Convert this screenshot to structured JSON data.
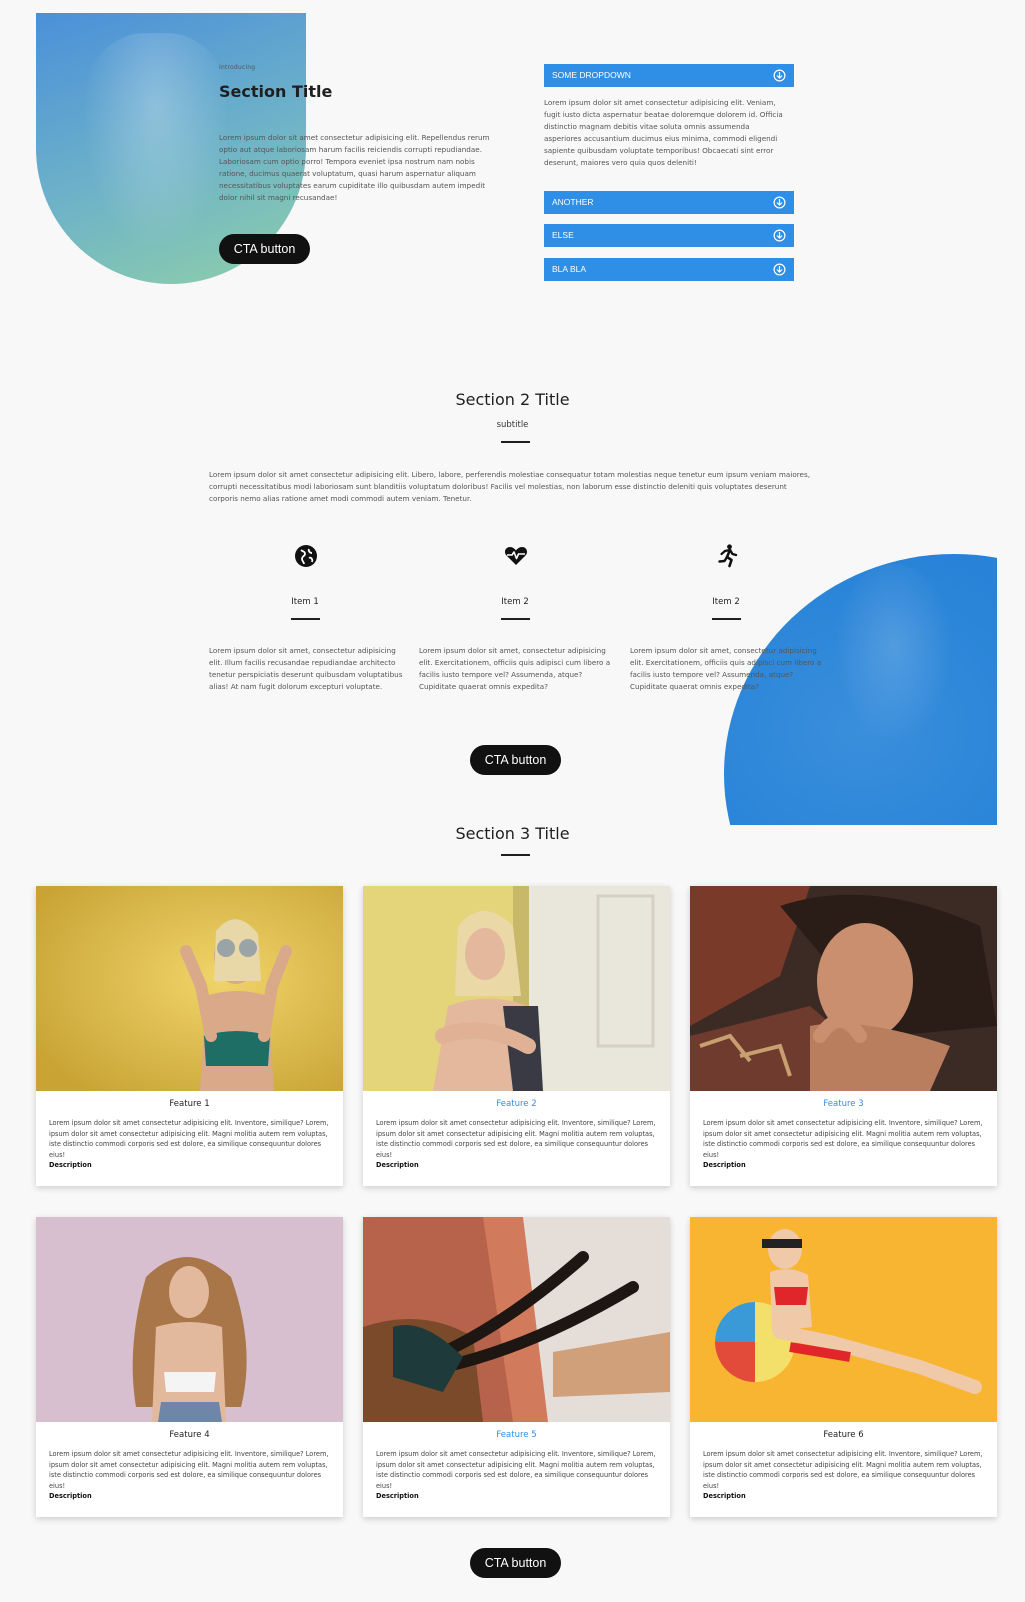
{
  "section1": {
    "eyebrow": "Introducing",
    "title": "Section Title",
    "body": "Lorem ipsum dolor sit amet consectetur adipisicing elit. Repellendus rerum optio aut atque laboriosam harum facilis reiciendis corrupti repudiandae. Laboriosam cum optio porro! Tempora eveniet ipsa nostrum nam nobis ratione, ducimus quaerat voluptatum, quasi harum aspernatur aliquam necessitatibus voluptates earum cupiditate illo quibusdam autem impedit dolor nihil sit magni recusandae!",
    "cta_label": "CTA button"
  },
  "accordion": {
    "items": [
      {
        "label": "SOME DROPDOWN",
        "icon": "chevron-circle-down-icon"
      },
      {
        "label": "ANOTHER",
        "icon": "chevron-circle-down-icon"
      },
      {
        "label": "ELSE",
        "icon": "chevron-circle-down-icon"
      },
      {
        "label": "BLA BLA",
        "icon": "chevron-circle-down-icon"
      }
    ],
    "open_body": "Lorem ipsum dolor sit amet consectetur adipisicing elit. Veniam, fugit iusto dicta aspernatur beatae doloremque dolorem id. Officia distinctio magnam debitis vitae soluta omnis assumenda asperiores accusantium ducimus eius minima, commodi eligendi sapiente quibusdam voluptate temporibus! Obcaecati sint error deserunt, maiores vero quia quos deleniti!",
    "accent_color": "#2f8ee6"
  },
  "section2": {
    "title": "Section 2 Title",
    "subtitle": "subtitle",
    "body": "Lorem ipsum dolor sit amet consectetur adipisicing elit. Libero, labore, perferendis molestiae consequatur totam molestias neque tenetur eum ipsum veniam maiores, corrupti necessitatibus modi laboriosam sunt blanditiis voluptatum doloribus! Facilis vel molestias, non laborum esse distinctio deleniti quis voluptates deserunt corporis nemo alias ratione amet modi commodi autem veniam. Tenetur.",
    "items": [
      {
        "icon": "globe-icon",
        "label": "Item 1",
        "text": "Lorem ipsum dolor sit amet, consectetur adipisicing elit. Illum facilis recusandae repudiandae architecto tenetur perspiciatis deserunt quibusdam voluptatibus alias! At nam fugit dolorum excepturi voluptate."
      },
      {
        "icon": "heartbeat-icon",
        "label": "Item 2",
        "text": "Lorem ipsum dolor sit amet, consectetur adipisicing elit. Exercitationem, officiis quis adipisci cum libero a facilis iusto tempore vel? Assumenda, atque? Cupiditate quaerat omnis expedita?"
      },
      {
        "icon": "running-icon",
        "label": "Item 2",
        "text": "Lorem ipsum dolor sit amet, consectetur adipisicing elit. Exercitationem, officiis quis adipisci cum libero a facilis iusto tempore vel? Assumenda, atque? Cupiditate quaerat omnis expedita?"
      }
    ],
    "cta_label": "CTA button"
  },
  "section3": {
    "title": "Section 3 Title",
    "cards": [
      {
        "title": "Feature 1",
        "highlight": false,
        "body": "Lorem ipsum dolor sit amet consectetur adipisicing elit. Inventore, similique? Lorem, ipsum dolor sit amet consectetur adipisicing elit. Magni molitia autem rem voluptas, iste distinctio commodi corporis sed est dolore, ea similique consequuntur dolores eius!",
        "desc": "Description"
      },
      {
        "title": "Feature 2",
        "highlight": true,
        "body": "Lorem ipsum dolor sit amet consectetur adipisicing elit. Inventore, similique? Lorem, ipsum dolor sit amet consectetur adipisicing elit. Magni molitia autem rem voluptas, iste distinctio commodi corporis sed est dolore, ea similique consequuntur dolores eius!",
        "desc": "Description"
      },
      {
        "title": "Feature 3",
        "highlight": true,
        "body": "Lorem ipsum dolor sit amet consectetur adipisicing elit. Inventore, similique? Lorem, ipsum dolor sit amet consectetur adipisicing elit. Magni molitia autem rem voluptas, iste distinctio commodi corporis sed est dolore, ea similique consequuntur dolores eius!",
        "desc": "Description"
      },
      {
        "title": "Feature 4",
        "highlight": false,
        "body": "Lorem ipsum dolor sit amet consectetur adipisicing elit. Inventore, similique? Lorem, ipsum dolor sit amet consectetur adipisicing elit. Magni molitia autem rem voluptas, iste distinctio commodi corporis sed est dolore, ea similique consequuntur dolores eius!",
        "desc": "Description"
      },
      {
        "title": "Feature 5",
        "highlight": true,
        "body": "Lorem ipsum dolor sit amet consectetur adipisicing elit. Inventore, similique? Lorem, ipsum dolor sit amet consectetur adipisicing elit. Magni molitia autem rem voluptas, iste distinctio commodi corporis sed est dolore, ea similique consequuntur dolores eius!",
        "desc": "Description"
      },
      {
        "title": "Feature 6",
        "highlight": false,
        "body": "Lorem ipsum dolor sit amet consectetur adipisicing elit. Inventore, similique? Lorem, ipsum dolor sit amet consectetur adipisicing elit. Magni molitia autem rem voluptas, iste distinctio commodi corporis sed est dolore, ea similique consequuntur dolores eius!",
        "desc": "Description"
      }
    ],
    "cta_label": "CTA button"
  },
  "colors": {
    "page_background": "#f8f8f8",
    "accent_blue": "#2f8ee6",
    "cta_background": "#111111"
  }
}
